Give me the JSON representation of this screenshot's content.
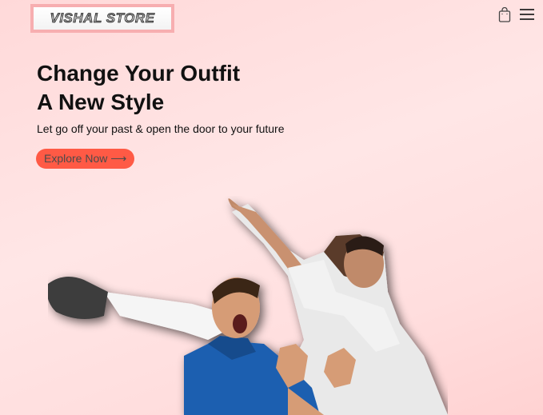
{
  "header": {
    "logo_text": "VISHAL STORE",
    "cart_icon": "shopping-bag-icon",
    "menu_icon": "hamburger-menu-icon"
  },
  "hero": {
    "title_line1": "Change Your Outfit",
    "title_line2": "A New Style",
    "subtitle": "Let go off your past & open the door to your future",
    "cta_label": "Explore Now ⟶"
  },
  "colors": {
    "accent": "#ff5a45",
    "logo_border": "#f7aeb0",
    "background": "#ffdede"
  }
}
